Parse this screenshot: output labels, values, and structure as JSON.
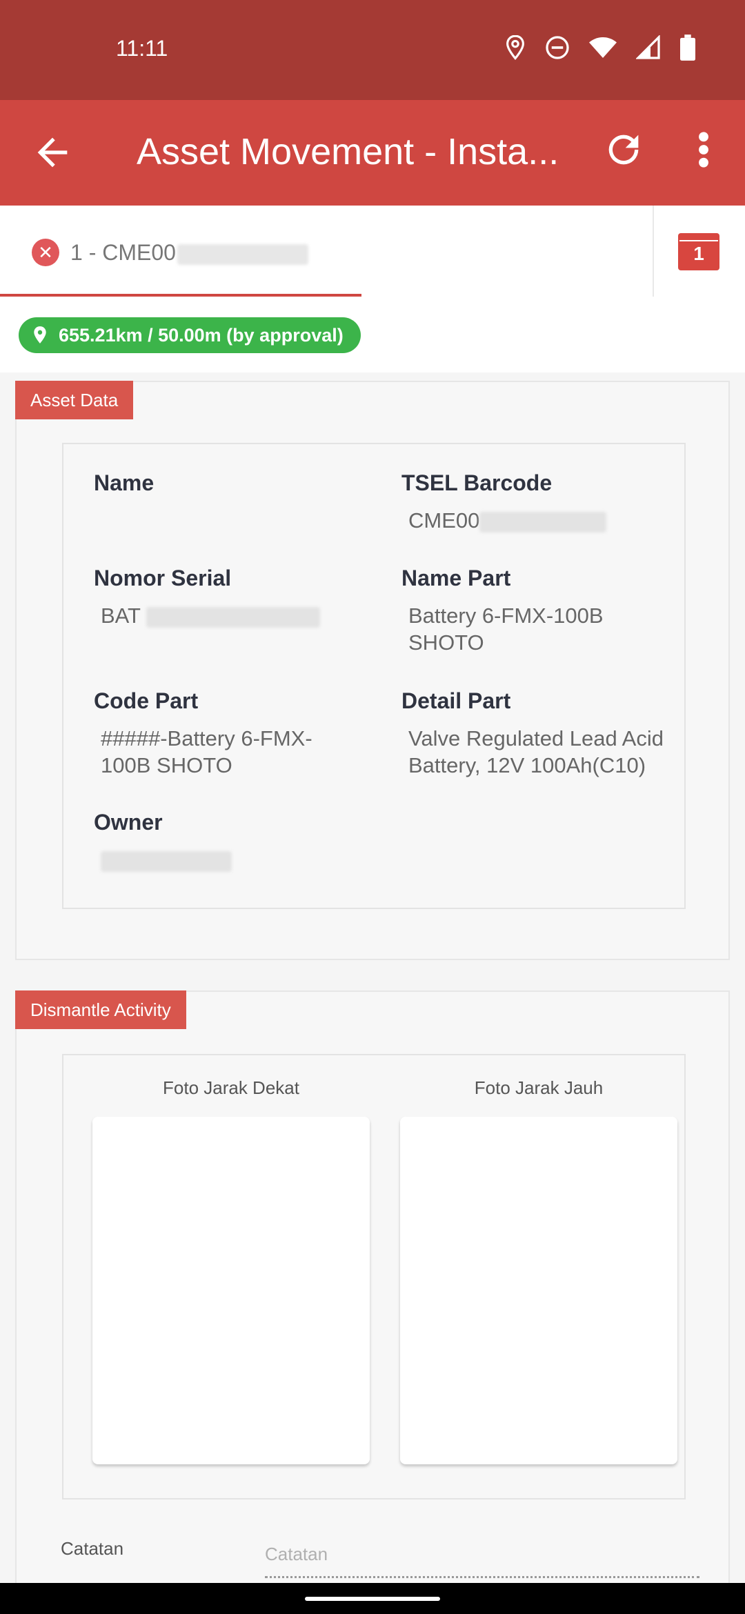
{
  "status_bar": {
    "time": "11:11"
  },
  "app_bar": {
    "title": "Asset Movement - Insta..."
  },
  "tab": {
    "label": "1 - CME00",
    "calendar_badge": "1"
  },
  "distance": {
    "text": "655.21km / 50.00m (by approval)",
    "color": "#3cb44a"
  },
  "asset_data": {
    "tag": "Asset Data",
    "fields": {
      "name": {
        "label": "Name",
        "value": ""
      },
      "tsel_barcode": {
        "label": "TSEL Barcode",
        "value": "CME00"
      },
      "nomor_serial": {
        "label": "Nomor Serial",
        "value": "BAT"
      },
      "name_part": {
        "label": "Name Part",
        "value": "Battery 6-FMX-100B SHOTO"
      },
      "code_part": {
        "label": "Code Part",
        "value": "#####-Battery 6-FMX-100B SHOTO"
      },
      "detail_part": {
        "label": "Detail Part",
        "value": "Valve Regulated Lead Acid Battery, 12V 100Ah(C10)"
      },
      "owner": {
        "label": "Owner",
        "value": ""
      }
    }
  },
  "dismantle": {
    "tag": "Dismantle Activity",
    "photo_near": "Foto Jarak Dekat",
    "photo_far": "Foto Jarak Jauh",
    "notes_label": "Catatan",
    "notes_placeholder": "Catatan"
  },
  "colors": {
    "status_bar": "#a53a34",
    "app_bar": "#cf4741",
    "tag": "#d8564d"
  }
}
